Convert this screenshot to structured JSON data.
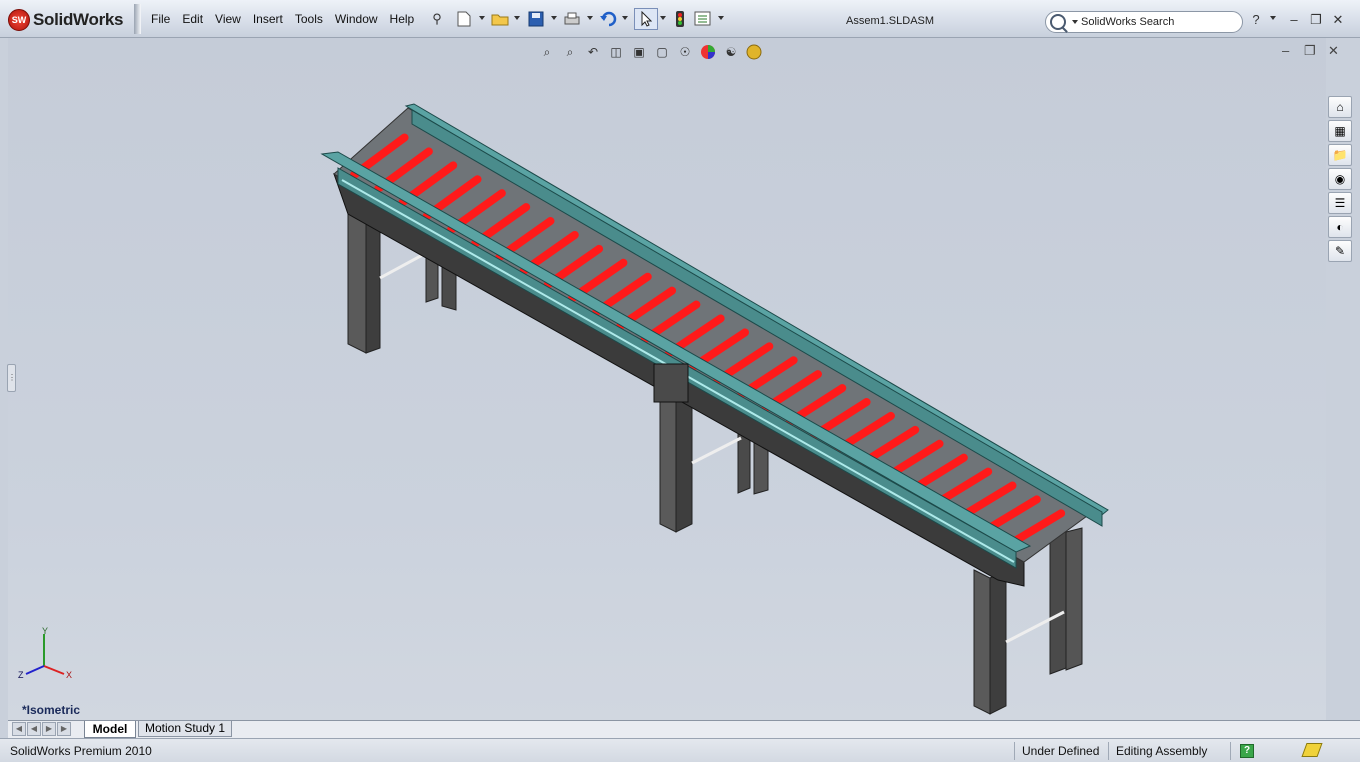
{
  "app": {
    "name": "SolidWorks",
    "logo_badge": "SW",
    "document_title": "Assem1.SLDASM",
    "product_edition": "SolidWorks Premium 2010"
  },
  "menu": {
    "items": [
      "File",
      "Edit",
      "View",
      "Insert",
      "Tools",
      "Window",
      "Help"
    ]
  },
  "search": {
    "placeholder": "SolidWorks Search"
  },
  "toolbar_icons": [
    "new-document-icon",
    "open-folder-icon",
    "save-icon",
    "print-icon",
    "undo-icon",
    "select-arrow-icon",
    "rebuild-traffic-light-icon",
    "options-icon"
  ],
  "heads_up_toolbar_icons": [
    "zoom-to-fit-icon",
    "zoom-to-area-icon",
    "previous-view-icon",
    "section-view-icon",
    "view-orientation-icon",
    "display-style-icon",
    "hide-show-items-icon",
    "edit-appearance-icon",
    "apply-scene-icon",
    "view-settings-icon"
  ],
  "task_pane_icons": [
    "home-icon",
    "design-library-icon",
    "file-explorer-icon",
    "view-palette-icon",
    "solidworks-resources-icon",
    "appearances-icon",
    "custom-properties-icon"
  ],
  "viewport": {
    "view_label": "*Isometric",
    "triad_axes": {
      "x": "X",
      "y": "Y",
      "z": "Z"
    }
  },
  "colors": {
    "rollers": "#ff1a1a",
    "guard_rails": "#5aa3a3",
    "frame": "#3a3a3a",
    "background": "#c9d0db"
  },
  "tabs": {
    "model": "Model",
    "motion_study": "Motion Study 1"
  },
  "status": {
    "definition": "Under Defined",
    "mode": "Editing Assembly",
    "help_badge": "?"
  }
}
